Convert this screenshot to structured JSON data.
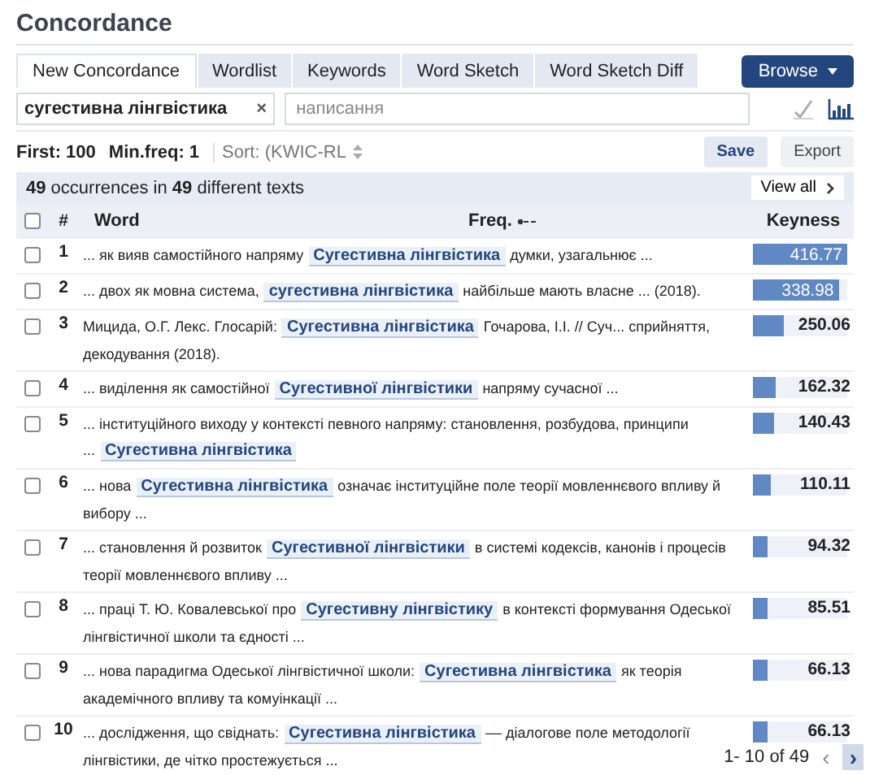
{
  "title": "Concordance",
  "tabs": [
    {
      "label": "New Concordance",
      "selected": true
    },
    {
      "label": "Wordlist",
      "selected": false
    },
    {
      "label": "Keywords",
      "selected": false
    },
    {
      "label": "Word Sketch",
      "selected": false
    },
    {
      "label": "Word Sketch Diff",
      "selected": false
    }
  ],
  "browse_button": "Browse",
  "search": {
    "query": "сугестивна лінгвістика",
    "clear": "×",
    "placeholder": "написання"
  },
  "options": {
    "first": "First: 100",
    "min_freq": "Min.freq: 1",
    "sort": "Sort: (KWIC-RL"
  },
  "actions": [
    {
      "label": "Save",
      "kind": "primary"
    },
    {
      "label": "Export",
      "kind": "plain"
    }
  ],
  "summary": "**49** occurrences in **49** different texts",
  "view_all": "View all",
  "table": {
    "all_checked": false,
    "columns": [
      "#",
      "Word",
      "Freq.",
      "Keyness"
    ],
    "rows": [
      {
        "checked": false,
        "num": "1",
        "left": "... як вияв самостійного напряму",
        "keyword": "Сугестивна лінгвістика",
        "right": "думки, узагальнює ...",
        "keyness": "416.77",
        "level": 1
      },
      {
        "checked": false,
        "num": "2",
        "left": "... двох як мовна система,",
        "keyword": "сугестивна лінгвістика",
        "right": "найбільше мають власне ... (2018).",
        "keyness": "338.98",
        "level": 0.91
      },
      {
        "checked": false,
        "num": "3",
        "left": "Мицида, О.Г. Лекс. Глосарій:",
        "keyword": "Сугестивна лінгвістика",
        "right": "Гочарова, І.І. // Суч... сприйняття, декодування (2018).",
        "keyness": "250.06",
        "level": 0.33
      },
      {
        "checked": false,
        "num": "4",
        "left": "... виділення як самостійної",
        "keyword": "Сугестивної лінгвістики",
        "right": "напряму сучасної ...",
        "keyness": "162.32",
        "level": 0.24
      },
      {
        "checked": false,
        "num": "5",
        "left": "... інституційного виходу у контексті певного напряму: становлення, розбудова, принципи ...",
        "keyword": "Сугестивна лінгвістика",
        "right": "",
        "keyness": "140.43",
        "level": 0.22
      },
      {
        "checked": false,
        "num": "6",
        "left": "... нова",
        "keyword": "Сугестивна лінгвістика",
        "right": "означає інституційне поле теорії мовленнєвого впливу й вибору ...",
        "keyness": "110.11",
        "level": 0.19
      },
      {
        "checked": false,
        "num": "7",
        "left": "... становлення й розвиток",
        "keyword": "Сугестивної лінгвістики",
        "right": "в системі кодексів, канонів і процесів теорії мовленнєвого впливу ...",
        "keyness": "94.32",
        "level": 0.16
      },
      {
        "checked": false,
        "num": "8",
        "left": "... праці Т. Ю. Ковалевської про",
        "keyword": "Сугестивну лінгвістику",
        "right": "в контексті формування Одеської лінгвістичної школи та єдності ...",
        "keyness": "85.51",
        "level": 0.16
      },
      {
        "checked": false,
        "num": "9",
        "left": "... нова парадигма Одеської лінгвістичної школи:",
        "keyword": "Сугестивна лінгвістика",
        "right": "як теорія академічного впливу та комуінкації ...",
        "keyness": "66.13",
        "level": 0.16
      },
      {
        "checked": false,
        "num": "10",
        "left": "... дослідження, що свіднать:",
        "keyword": "Сугестивна лінгвістика",
        "right": "–– діалогове поле методології лінгвістики, де чітко простежується ...",
        "keyness": "66.13",
        "level": 0.16
      }
    ]
  },
  "pagination": {
    "range": "1- 10 of 49",
    "prev": "‹",
    "next": "›"
  }
}
